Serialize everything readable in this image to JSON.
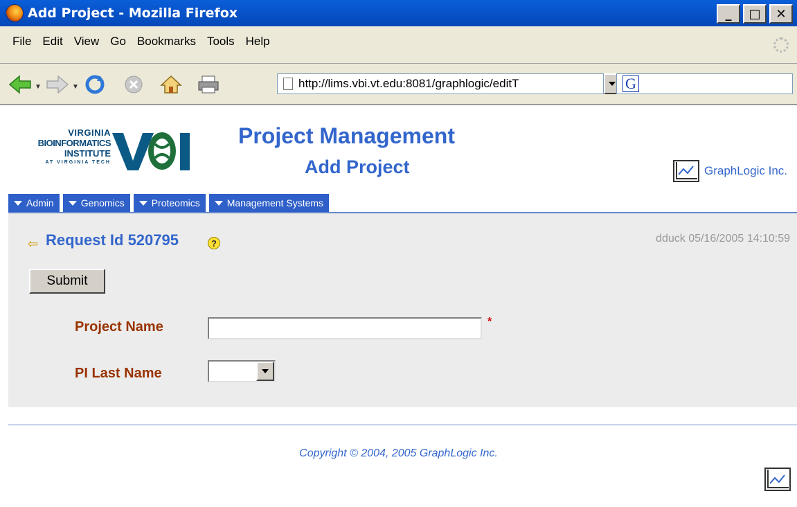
{
  "window": {
    "title": "Add Project - Mozilla Firefox",
    "controls": [
      "_",
      "□",
      "✕"
    ]
  },
  "menu": {
    "items": [
      "File",
      "Edit",
      "View",
      "Go",
      "Bookmarks",
      "Tools",
      "Help"
    ]
  },
  "toolbar": {
    "url": "http://lims.vbi.vt.edu:8081/graphlogic/editT",
    "search_logo": "G"
  },
  "logo": {
    "line1": "VIRGINIA",
    "line2": "BIOINFORMATICS",
    "line3": "INSTITUTE",
    "line4": "AT VIRGINIA TECH",
    "mark": "VBI"
  },
  "header": {
    "title": "Project Management",
    "subtitle": "Add Project",
    "company": "GraphLogic Inc."
  },
  "nav": {
    "tabs": [
      "Admin",
      "Genomics",
      "Proteomics",
      "Management Systems"
    ]
  },
  "request": {
    "label": "Request Id 520795",
    "help": "?",
    "user_stamp": "dduck  05/16/2005 14:10:59"
  },
  "form": {
    "submit_label": "Submit",
    "project_name_label": "Project Name",
    "project_name_value": "",
    "required_mark": "*",
    "pi_last_name_label": "PI Last Name",
    "pi_last_name_value": ""
  },
  "footer": {
    "copyright": "Copyright © 2004, 2005 GraphLogic Inc."
  },
  "colors": {
    "title_blue": "#3366cc",
    "label_brown": "#993300",
    "nav_blue": "#2f5fc8"
  }
}
